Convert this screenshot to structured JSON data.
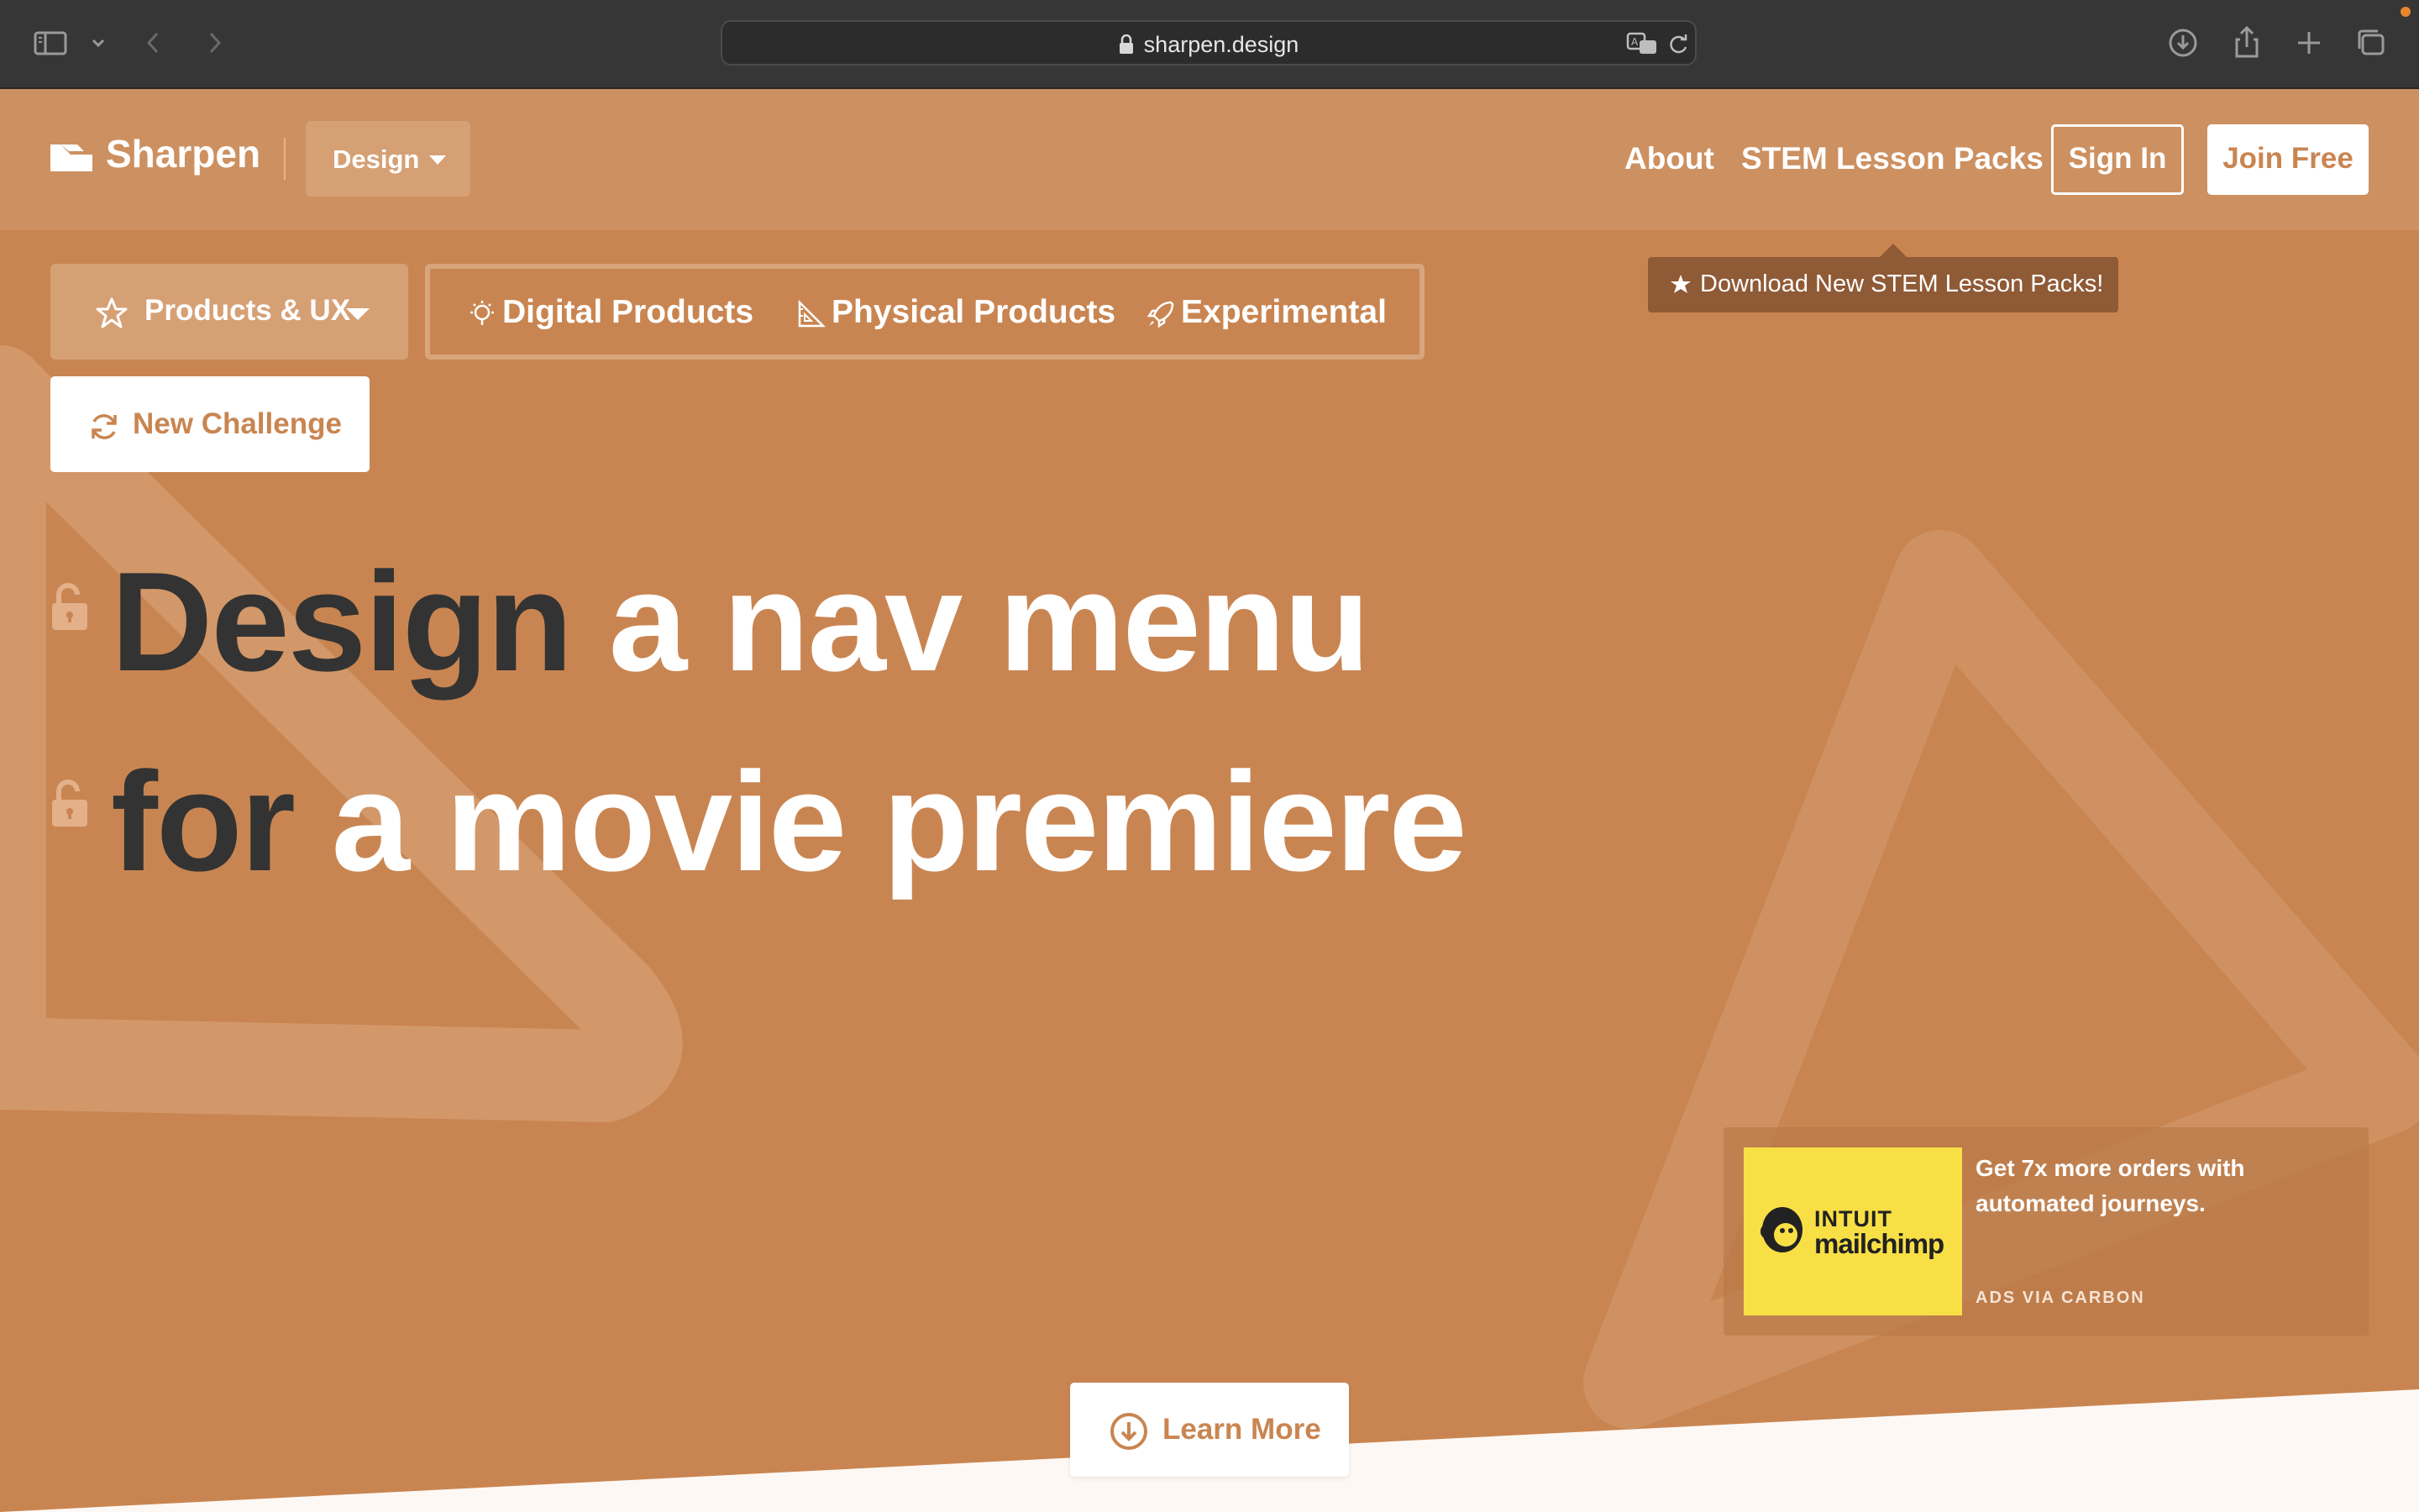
{
  "browser": {
    "url": "sharpen.design",
    "icons": [
      "sidebar-icon",
      "chevron-down-icon",
      "back-icon",
      "forward-icon",
      "lock-icon",
      "translate-icon",
      "reload-icon",
      "download-icon",
      "share-icon",
      "new-tab-icon",
      "tab-overview-icon"
    ]
  },
  "header": {
    "logo": "Sharpen",
    "discipline": "Design",
    "nav": {
      "about": "About",
      "stem": "STEM Lesson Packs",
      "sign_in": "Sign In",
      "join": "Join Free"
    }
  },
  "tooltip": {
    "text": "Download New STEM Lesson Packs!"
  },
  "category": {
    "selected": "Products & UX",
    "tabs": [
      {
        "label": "Digital Products",
        "icon": "lightbulb-icon"
      },
      {
        "label": "Physical Products",
        "icon": "ruler-triangle-icon"
      },
      {
        "label": "Experimental",
        "icon": "rocket-icon"
      }
    ]
  },
  "new_challenge": "New Challenge",
  "challenge": {
    "line1": {
      "keyword": "Design",
      "rest": " a nav menu"
    },
    "line2": {
      "keyword": "for",
      "rest": " a movie premiere"
    }
  },
  "ad": {
    "brand_line1": "INTUIT",
    "brand_line2": "mailchimp",
    "text": "Get 7x more orders with automated journeys.",
    "via": "ADS VIA CARBON"
  },
  "learn_more": "Learn More",
  "colors": {
    "brand": "#c98551",
    "header": "#cd9060",
    "tooltip": "#8f5a36",
    "dark_text": "#333333",
    "ad_image": "#f8df45"
  }
}
